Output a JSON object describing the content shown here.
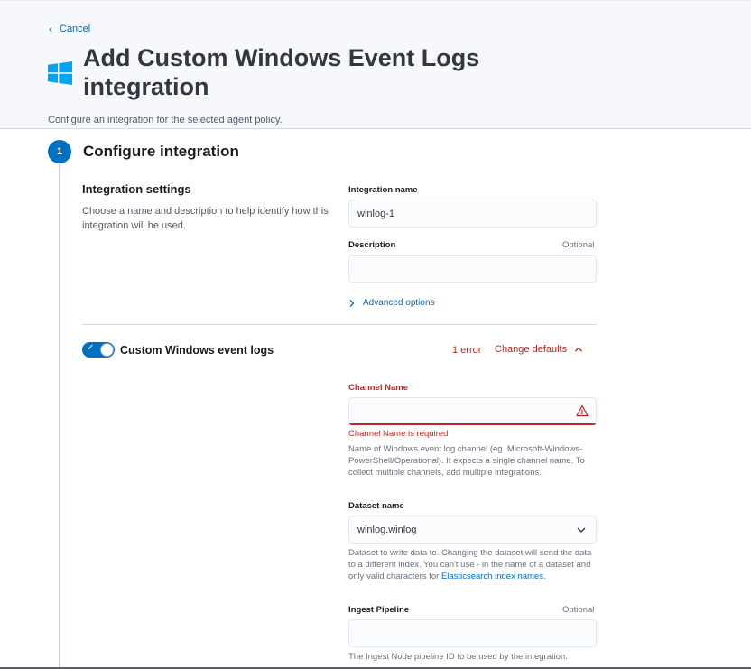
{
  "header": {
    "cancel_label": "Cancel",
    "title": "Add Custom Windows Event Logs integration",
    "subtitle": "Configure an integration for the selected agent policy."
  },
  "step": {
    "number": "1",
    "title": "Configure integration"
  },
  "settings": {
    "title": "Integration settings",
    "description": "Choose a name and description to help identify how this integration will be used.",
    "name_label": "Integration name",
    "name_value": "winlog-1",
    "description_label": "Description",
    "description_optional": "Optional",
    "description_value": "",
    "advanced_label": "Advanced options"
  },
  "stream": {
    "title": "Custom Windows event logs",
    "enabled": true,
    "error_count": "1 error",
    "change_defaults_label": "Change defaults"
  },
  "fields": {
    "channel_label": "Channel Name",
    "channel_value": "",
    "channel_error": "Channel Name is required",
    "channel_help": "Name of Windows event log channel (eg. Microsoft-Windows-PowerShell/Operational). It expects a single channel name. To collect multiple channels, add multiple integrations.",
    "dataset_label": "Dataset name",
    "dataset_value": "winlog.winlog",
    "dataset_help_prefix": "Dataset to write data to. Changing the dataset will send the data to a different index. You can't use - in the name of a dataset and only valid characters for ",
    "dataset_help_link": "Elasticsearch index names",
    "dataset_help_suffix": ".",
    "pipeline_label": "Ingest Pipeline",
    "pipeline_optional": "Optional",
    "pipeline_value": "",
    "pipeline_help": "The Ingest Node pipeline ID to be used by the integration."
  },
  "colors": {
    "accent": "#0071c2",
    "link": "#006bb8",
    "danger": "#bd271e",
    "windows_logo": "#00a4ef"
  },
  "icons": {
    "cancel": "chevron-left-icon",
    "logo": "windows-logo-icon",
    "advanced": "chevron-right-icon",
    "change_defaults": "chevron-up-icon",
    "channel_error": "warning-icon",
    "dataset": "chevron-down-icon"
  }
}
